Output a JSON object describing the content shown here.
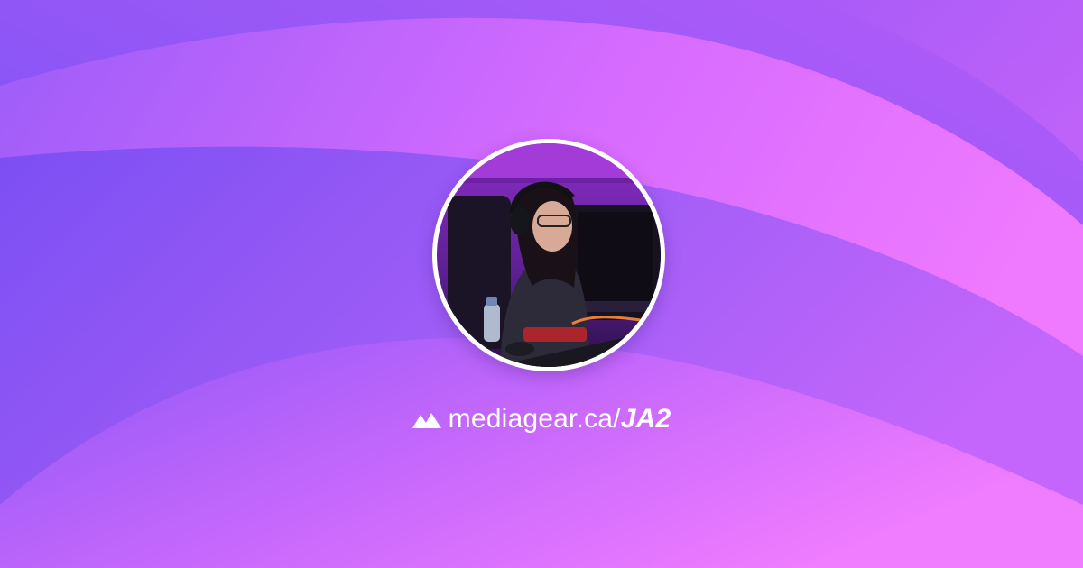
{
  "profile": {
    "domain": "mediagear.ca/",
    "username": "JA2"
  },
  "icons": {
    "logo": "mountain-logo-icon"
  },
  "colors": {
    "background_primary": "#8a55f5",
    "background_pink": "#e96cff",
    "background_deep": "#6c47f2",
    "text": "#ffffff",
    "avatar_ring": "#ffffff"
  }
}
